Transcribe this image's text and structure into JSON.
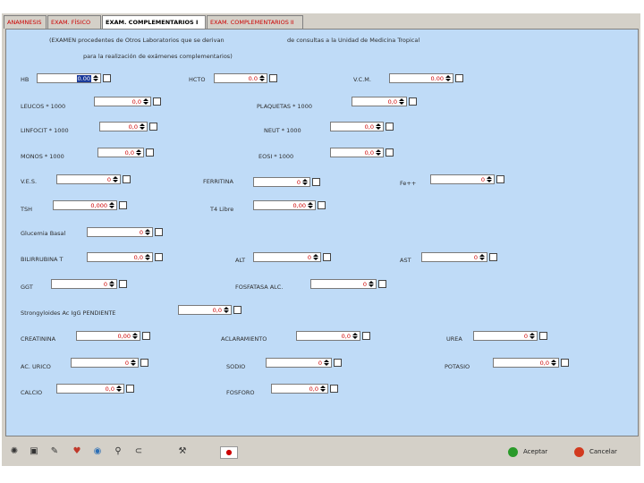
{
  "tabs": [
    {
      "label": "ANAMNESIS"
    },
    {
      "label": "EXAM. FÍSICO"
    },
    {
      "label": "EXAM. COMPLEMENTARIOS I"
    },
    {
      "label": "EXAM. COMPLEMENTARIOS II"
    }
  ],
  "notes": {
    "line1": "(EXAMEN procedentes de Otros Laboratorios que se derivan",
    "line1b": "de consultas a la Unidad de Medicina Tropical",
    "line2": "para la realización de exámenes complementarios)"
  },
  "fields": [
    {
      "label": "HB",
      "value": "0.00"
    },
    {
      "label": "HCTO",
      "value": "0.0"
    },
    {
      "label": "V.C.M.",
      "value": "0.00"
    },
    {
      "label": "LEUCOS * 1000",
      "value": "0,0"
    },
    {
      "label": "PLAQUETAS * 1000",
      "value": "0,0"
    },
    {
      "label": "LINFOCIT * 1000",
      "value": "0,0"
    },
    {
      "label": "NEUT * 1000",
      "value": "0,0"
    },
    {
      "label": "MONOS * 1000",
      "value": "0,0"
    },
    {
      "label": "EOSI * 1000",
      "value": "0,0"
    },
    {
      "label": "V.E.S.",
      "value": "0"
    },
    {
      "label": "FERRITINA",
      "value": "0"
    },
    {
      "label": "Fe++",
      "value": "0"
    },
    {
      "label": "TSH",
      "value": "0,000"
    },
    {
      "label": "T4 Libre",
      "value": "0,00"
    },
    {
      "label": "Glucemia Basal",
      "value": "0"
    },
    {
      "label": "BILIRRUBINA T",
      "value": "0,0"
    },
    {
      "label": "ALT",
      "value": "0"
    },
    {
      "label": "AST",
      "value": "0"
    },
    {
      "label": "GGT",
      "value": "0"
    },
    {
      "label": "FOSFATASA ALC.",
      "value": "0"
    },
    {
      "label": "Strongyloides Ac IgG PENDIENTE",
      "value": "0,0"
    },
    {
      "label": "CREATININA",
      "value": "0,00"
    },
    {
      "label": "ACLARAMIENTO",
      "value": "0,0"
    },
    {
      "label": "UREA",
      "value": "0"
    },
    {
      "label": "AC. URICO",
      "value": "0"
    },
    {
      "label": "SODIO",
      "value": "0"
    },
    {
      "label": "POTASIO",
      "value": "0,0"
    },
    {
      "label": "CALCIO",
      "value": "0,0"
    },
    {
      "label": "FOSFORO",
      "value": "0,0"
    }
  ],
  "buttons": {
    "accept": "Aceptar",
    "cancel": "Cancelar"
  },
  "colors": {
    "panel": "#bfdbf7",
    "value_text": "#cc0000",
    "accept_icon": "#2a9a2a",
    "cancel_icon": "#d23a1f"
  },
  "toolbar_icons": [
    "tools-icon",
    "save-icon",
    "edit-icon",
    "heart-icon",
    "globe-icon",
    "search-icon",
    "link-icon",
    "hammer-icon",
    "flag-icon"
  ]
}
